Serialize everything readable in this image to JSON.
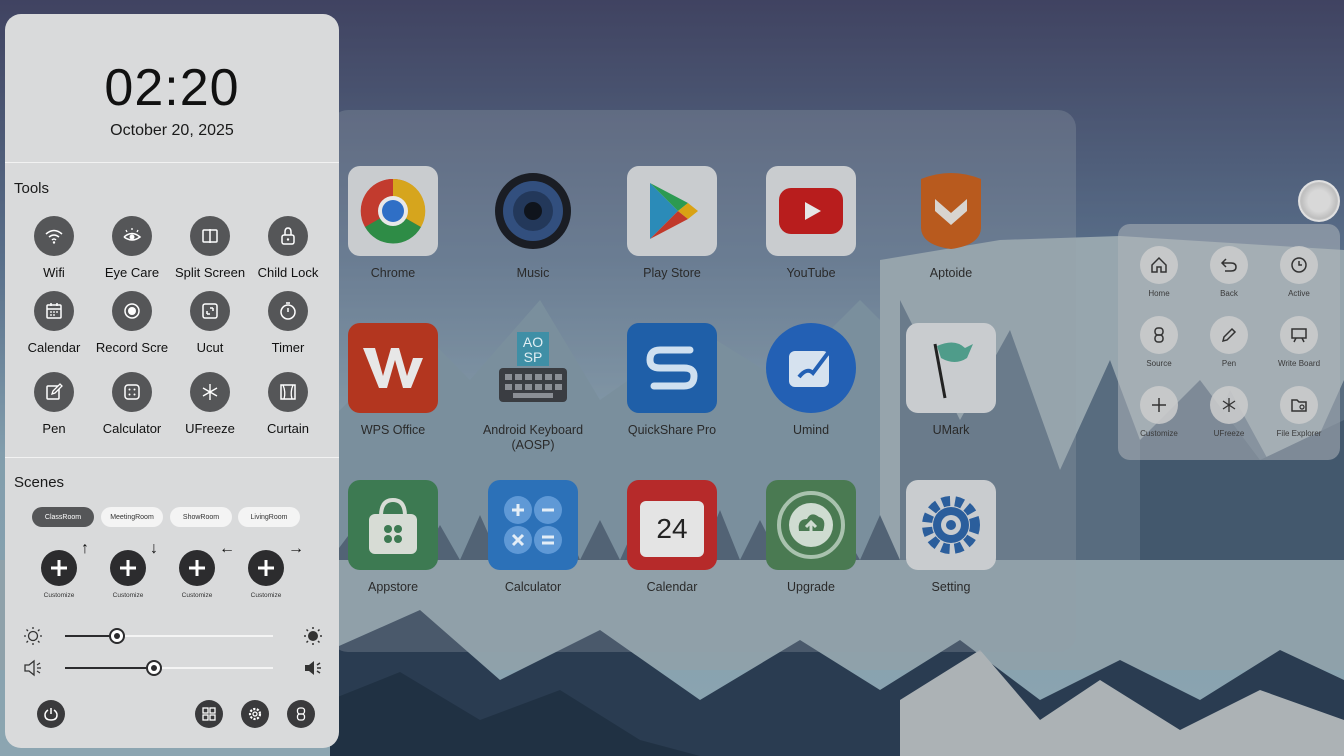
{
  "control_panel": {
    "time": "02:20",
    "date": "October 20, 2025",
    "tools_title": "Tools",
    "tools": [
      {
        "label": "Wifi",
        "icon": "wifi-icon"
      },
      {
        "label": "Eye Care",
        "icon": "eye-care-icon"
      },
      {
        "label": "Split Screen",
        "icon": "split-screen-icon"
      },
      {
        "label": "Child Lock",
        "icon": "lock-icon"
      },
      {
        "label": "Calendar",
        "icon": "calendar-icon"
      },
      {
        "label": "Record Scre",
        "icon": "record-icon"
      },
      {
        "label": "Ucut",
        "icon": "ucut-icon"
      },
      {
        "label": "Timer",
        "icon": "timer-icon"
      },
      {
        "label": "Pen",
        "icon": "pen-icon"
      },
      {
        "label": "Calculator",
        "icon": "calculator-icon"
      },
      {
        "label": "UFreeze",
        "icon": "snowflake-icon"
      },
      {
        "label": "Curtain",
        "icon": "curtain-icon"
      }
    ],
    "scenes_title": "Scenes",
    "scenes": [
      "ClassRoom",
      "MeetingRoom",
      "ShowRoom",
      "LivingRoom"
    ],
    "active_scene": "ClassRoom",
    "customize": [
      {
        "label": "Customize",
        "arrow": "↑"
      },
      {
        "label": "Customize",
        "arrow": "↓"
      },
      {
        "label": "Customize",
        "arrow": "←"
      },
      {
        "label": "Customize",
        "arrow": "→"
      }
    ],
    "brightness_level": 0.25,
    "volume_level": 0.43
  },
  "apps": [
    {
      "label": "Chrome",
      "icon": "chrome-icon"
    },
    {
      "label": "Music",
      "icon": "music-icon"
    },
    {
      "label": "Play Store",
      "icon": "play-store-icon"
    },
    {
      "label": "YouTube",
      "icon": "youtube-icon"
    },
    {
      "label": "Aptoide",
      "icon": "aptoide-icon"
    },
    {
      "label": "WPS Office",
      "icon": "wps-office-icon"
    },
    {
      "label": "Android Keyboard\n(AOSP)",
      "icon": "keyboard-icon",
      "tile_text": "AO\nSP"
    },
    {
      "label": "QuickShare Pro",
      "icon": "quickshare-icon"
    },
    {
      "label": "Umind",
      "icon": "umind-icon"
    },
    {
      "label": "UMark",
      "icon": "umark-icon"
    },
    {
      "label": "Appstore",
      "icon": "appstore-icon"
    },
    {
      "label": "Calculator",
      "icon": "calculator-app-icon"
    },
    {
      "label": "Calendar",
      "icon": "calendar-app-icon",
      "tile_text": "24"
    },
    {
      "label": "Upgrade",
      "icon": "upgrade-icon"
    },
    {
      "label": "Setting",
      "icon": "setting-icon"
    }
  ],
  "float_toolbar": [
    {
      "label": "Home",
      "icon": "home-icon"
    },
    {
      "label": "Back",
      "icon": "back-icon"
    },
    {
      "label": "Active",
      "icon": "clock-icon"
    },
    {
      "label": "Source",
      "icon": "source-icon"
    },
    {
      "label": "Pen",
      "icon": "pen-icon"
    },
    {
      "label": "Write Board",
      "icon": "write-board-icon"
    },
    {
      "label": "Customize",
      "icon": "plus-icon"
    },
    {
      "label": "UFreeze",
      "icon": "snowflake-icon"
    },
    {
      "label": "File Explorer",
      "icon": "folder-icon"
    }
  ]
}
